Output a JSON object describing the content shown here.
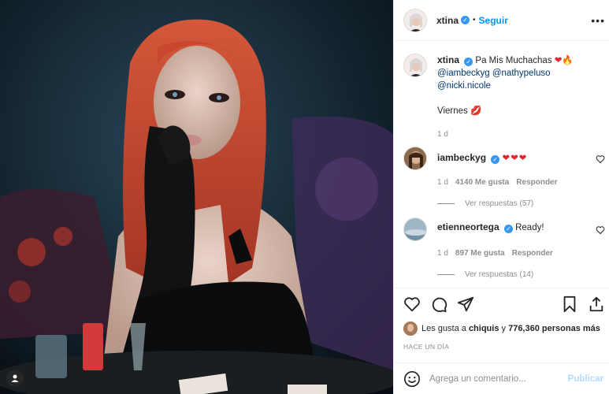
{
  "post": {
    "username": "xtina",
    "follow_label": "Seguir",
    "separator": "•",
    "caption_text": "Pa Mis Muchachas",
    "caption_mentions": [
      "@iambeckyg",
      "@nathypeluso",
      "@nicki.nicole"
    ],
    "caption_line2": "Viernes",
    "caption_time": "1 d"
  },
  "comments": [
    {
      "username": "iambeckyg",
      "time": "1 d",
      "likes": "4140 Me gusta",
      "reply_label": "Responder",
      "view_replies": "Ver respuestas (57)"
    },
    {
      "username": "etienneortega",
      "text": "Ready!",
      "time": "1 d",
      "likes": "897 Me gusta",
      "reply_label": "Responder",
      "view_replies": "Ver respuestas (14)"
    }
  ],
  "likes": {
    "prefix": "Les gusta a",
    "user": "chiquis",
    "middle": "y",
    "count": "776,360 personas más"
  },
  "timestamp": "HACE UN DÍA",
  "composer": {
    "placeholder": "Agrega un comentario...",
    "post_label": "Publicar"
  },
  "colors": {
    "accent": "#0095f6",
    "verified": "#3897f0",
    "muted": "#8e8e8e",
    "heart": "#ed1c24"
  },
  "icons": {
    "like": "heart-icon",
    "comment": "comment-icon",
    "share": "paper-plane-icon",
    "save": "bookmark-icon",
    "more": "more-options-icon",
    "emoji": "emoji-icon"
  }
}
